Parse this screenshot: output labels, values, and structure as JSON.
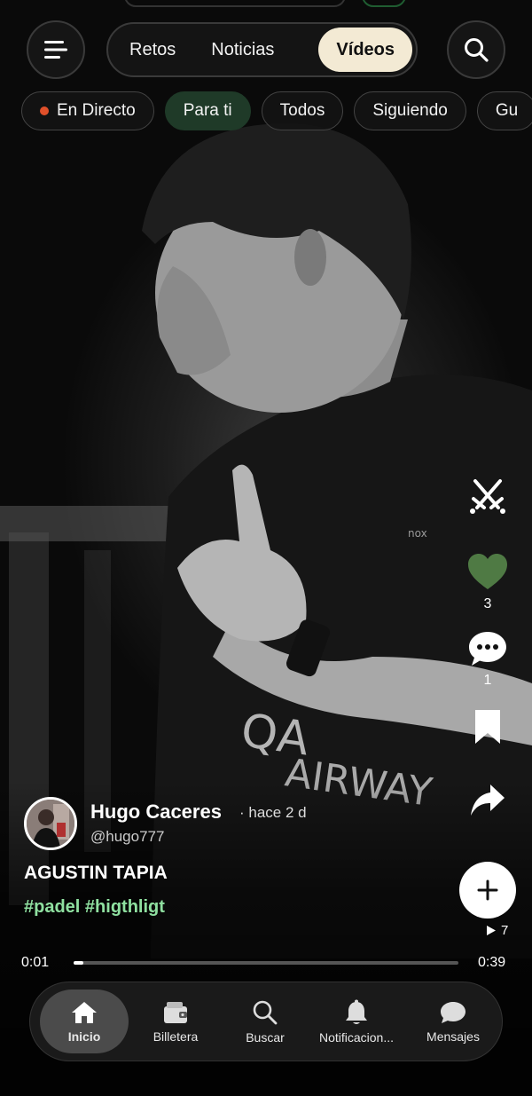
{
  "top_bar": {
    "tabs": [
      {
        "label": "Retos",
        "active": false
      },
      {
        "label": "Noticias",
        "active": false
      },
      {
        "label": "Vídeos",
        "active": true
      }
    ]
  },
  "filters": [
    {
      "label": "En Directo",
      "live": true
    },
    {
      "label": "Para ti",
      "active": true
    },
    {
      "label": "Todos"
    },
    {
      "label": "Siguiendo"
    },
    {
      "label": "Gu"
    }
  ],
  "actions": {
    "challenge_icon": "crossed-swords-icon",
    "likes": "3",
    "comments": "1",
    "bookmark_icon": "bookmark-icon",
    "share_icon": "share-icon"
  },
  "views": "7",
  "post": {
    "author": "Hugo Caceres",
    "time_ago": "· hace 2 d",
    "handle": "@hugo777",
    "caption": "AGUSTIN TAPIA",
    "hashtags": "#padel #higthligt"
  },
  "player": {
    "current_time": "0:01",
    "total_time": "0:39",
    "progress": 0.025
  },
  "bottom_nav": [
    {
      "label": "Inicio",
      "icon": "home-icon",
      "active": true
    },
    {
      "label": "Billetera",
      "icon": "wallet-icon"
    },
    {
      "label": "Buscar",
      "icon": "search-icon"
    },
    {
      "label": "Notificacion...",
      "icon": "bell-icon"
    },
    {
      "label": "Mensajes",
      "icon": "chat-icon"
    }
  ],
  "colors": {
    "accent_active_tab": "#f3ead4",
    "chip_active": "#1f3a28",
    "like_green": "#4f7a44",
    "hashtag_green": "#8fe0a0",
    "live_dot": "#e0502a"
  }
}
